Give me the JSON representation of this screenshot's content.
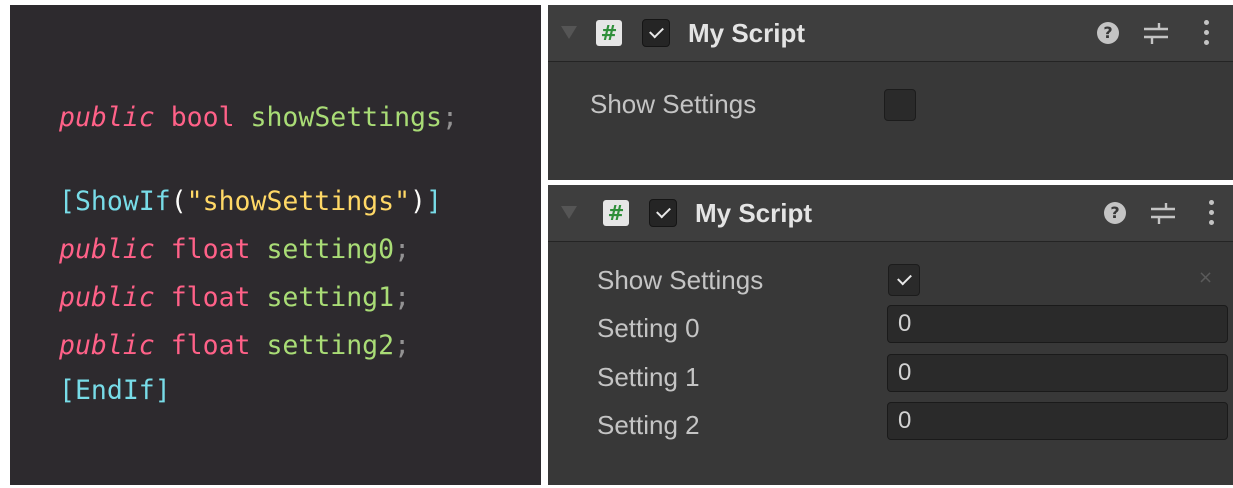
{
  "code": {
    "public_kw": "public",
    "bool_type": "bool",
    "float_type": "float",
    "show_field": "showSettings",
    "semicolon": ";",
    "show_if_attr": "ShowIf",
    "show_if_arg": "\"showSettings\"",
    "end_if_attr": "EndIf",
    "open_bracket": "[",
    "close_bracket": "]",
    "open_paren": "(",
    "close_paren": ")",
    "setting_fields": [
      "setting0",
      "setting1",
      "setting2"
    ]
  },
  "inspector_top": {
    "title": "My Script",
    "script_icon_glyph": "#",
    "help_glyph": "?",
    "enabled": true,
    "show_settings_label": "Show Settings",
    "show_settings_checked": false
  },
  "inspector_bottom": {
    "title": "My Script",
    "script_icon_glyph": "#",
    "help_glyph": "?",
    "enabled": true,
    "show_settings_label": "Show Settings",
    "show_settings_checked": true,
    "clear_glyph": "×",
    "fields": [
      {
        "label": "Setting 0",
        "value": "0"
      },
      {
        "label": "Setting 1",
        "value": "0"
      },
      {
        "label": "Setting 2",
        "value": "0"
      }
    ]
  },
  "icons": {
    "foldout": "triangle-down-icon",
    "script": "csharp-script-icon",
    "help": "help-icon",
    "presets": "sliders-icon",
    "menu": "kebab-menu-icon",
    "check": "checkmark-icon",
    "clear": "close-icon"
  },
  "colors": {
    "code_background": "#2d2a2e",
    "keyword": "#ff6188",
    "identifier": "#a9dc76",
    "string": "#ffd866",
    "attribute": "#78dce8",
    "inspector_background": "#383838",
    "inspector_header": "#3e3e3e"
  }
}
